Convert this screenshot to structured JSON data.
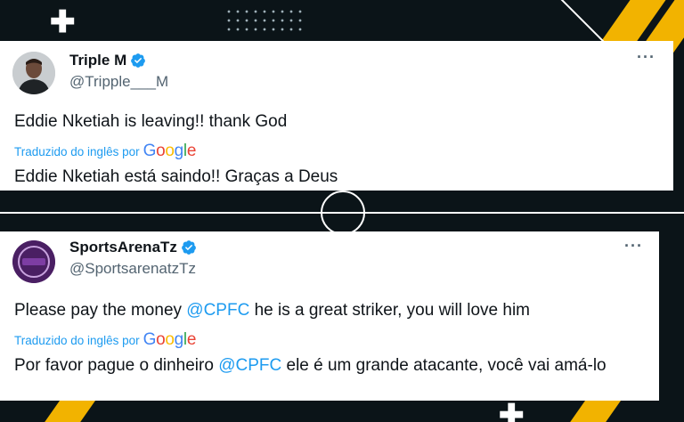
{
  "colors": {
    "accent": "#1d9bf0",
    "text": "#0f1419",
    "muted": "#536471",
    "background": "#0b1418",
    "stripe": "#f2b300"
  },
  "tweets": [
    {
      "name": "Triple M",
      "handle": "@Tripple___M",
      "verified_icon": "verified-badge-icon",
      "more_label": "···",
      "text": "Eddie Nketiah is leaving!! thank God",
      "translated_by": "Traduzido do inglês por",
      "translator": "Google",
      "translation": "Eddie Nketiah está saindo!! Graças a Deus"
    },
    {
      "name": "SportsArenaTz",
      "handle": "@SportsarenatzTz",
      "verified_icon": "verified-badge-icon",
      "more_label": "···",
      "text_before": "Please pay the money ",
      "mention": "@CPFC",
      "text_after": " he is a great striker, you will love him",
      "translated_by": "Traduzido do inglês por",
      "translator": "Google",
      "translation_before": "Por favor pague o dinheiro ",
      "translation_mention": "@CPFC",
      "translation_after": " ele é um grande atacante, você vai amá-lo"
    }
  ]
}
